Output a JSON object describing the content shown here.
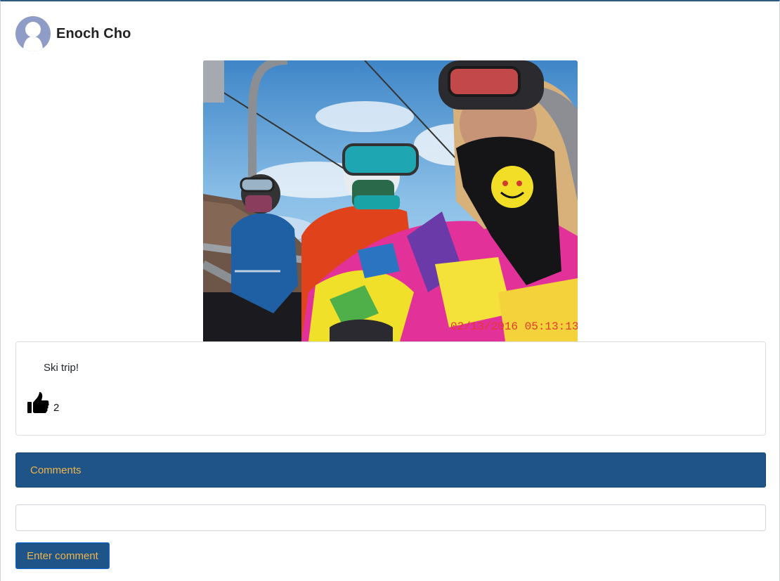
{
  "post": {
    "author": "Enoch Cho",
    "avatar_icon": "user-silhouette-icon",
    "photo_timestamp": "02/13/2016 05:13:13",
    "caption": "Ski trip!",
    "like_icon": "thumbs-up-icon",
    "like_count": "2"
  },
  "comments": {
    "header": "Comments",
    "input_value": "",
    "input_placeholder": "",
    "submit_label": "Enter comment"
  },
  "colors": {
    "accent_bg": "#1f5489",
    "accent_text": "#f0b54a",
    "avatar_bg": "#8f9cc6"
  }
}
